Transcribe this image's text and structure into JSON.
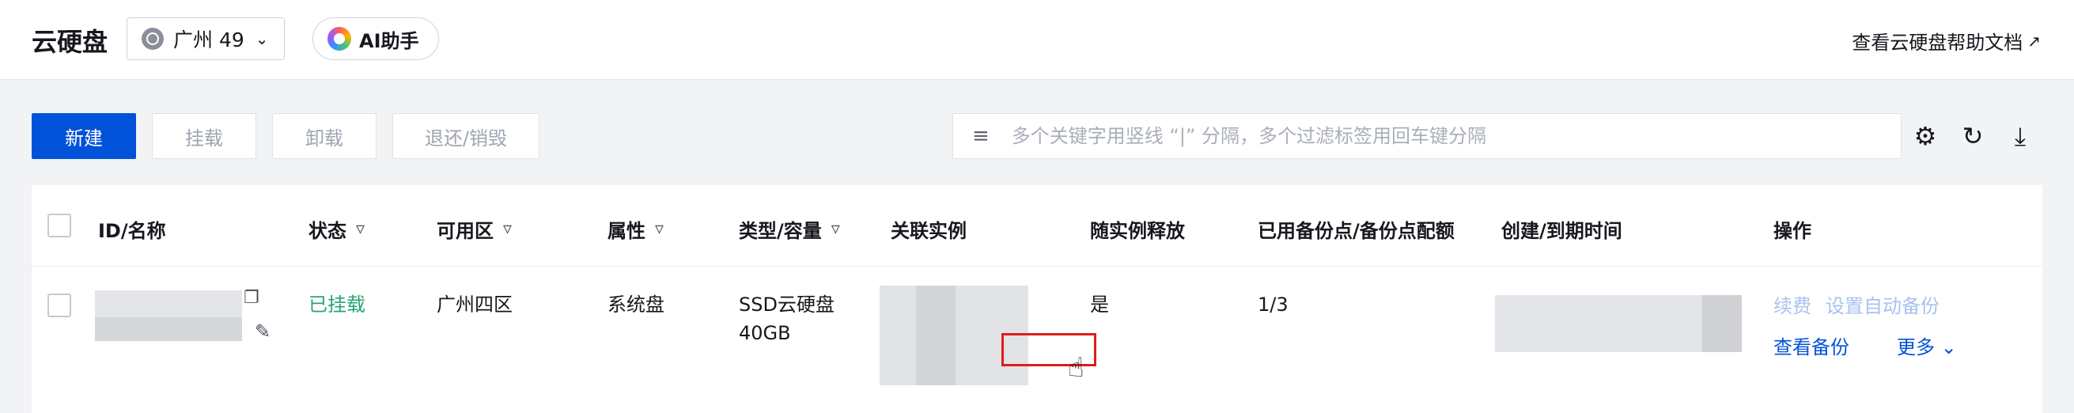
{
  "header": {
    "title": "云硬盘",
    "region": "广州 49",
    "ai_label": "AI助手",
    "help_link": "查看云硬盘帮助文档"
  },
  "toolbar": {
    "new_label": "新建",
    "mount_label": "挂载",
    "unmount_label": "卸载",
    "return_label": "退还/销毁",
    "search_placeholder": "多个关键字用竖线 “|” 分隔，多个过滤标签用回车键分隔"
  },
  "table": {
    "columns": {
      "id": "ID/名称",
      "status": "状态",
      "zone": "可用区",
      "attr": "属性",
      "type": "类型/容量",
      "instance": "关联实例",
      "release": "随实例释放",
      "backup": "已用备份点/备份点配额",
      "time": "创建/到期时间",
      "ops": "操作"
    },
    "row": {
      "status": "已挂载",
      "zone": "广州四区",
      "attr": "系统盘",
      "type_line1": "SSD云硬盘",
      "type_line2": "40GB",
      "release": "是",
      "backup": "1/3",
      "op_renew": "续费",
      "op_auto_backup": "设置自动备份",
      "op_view_backup": "查看备份",
      "op_more": "更多"
    }
  }
}
